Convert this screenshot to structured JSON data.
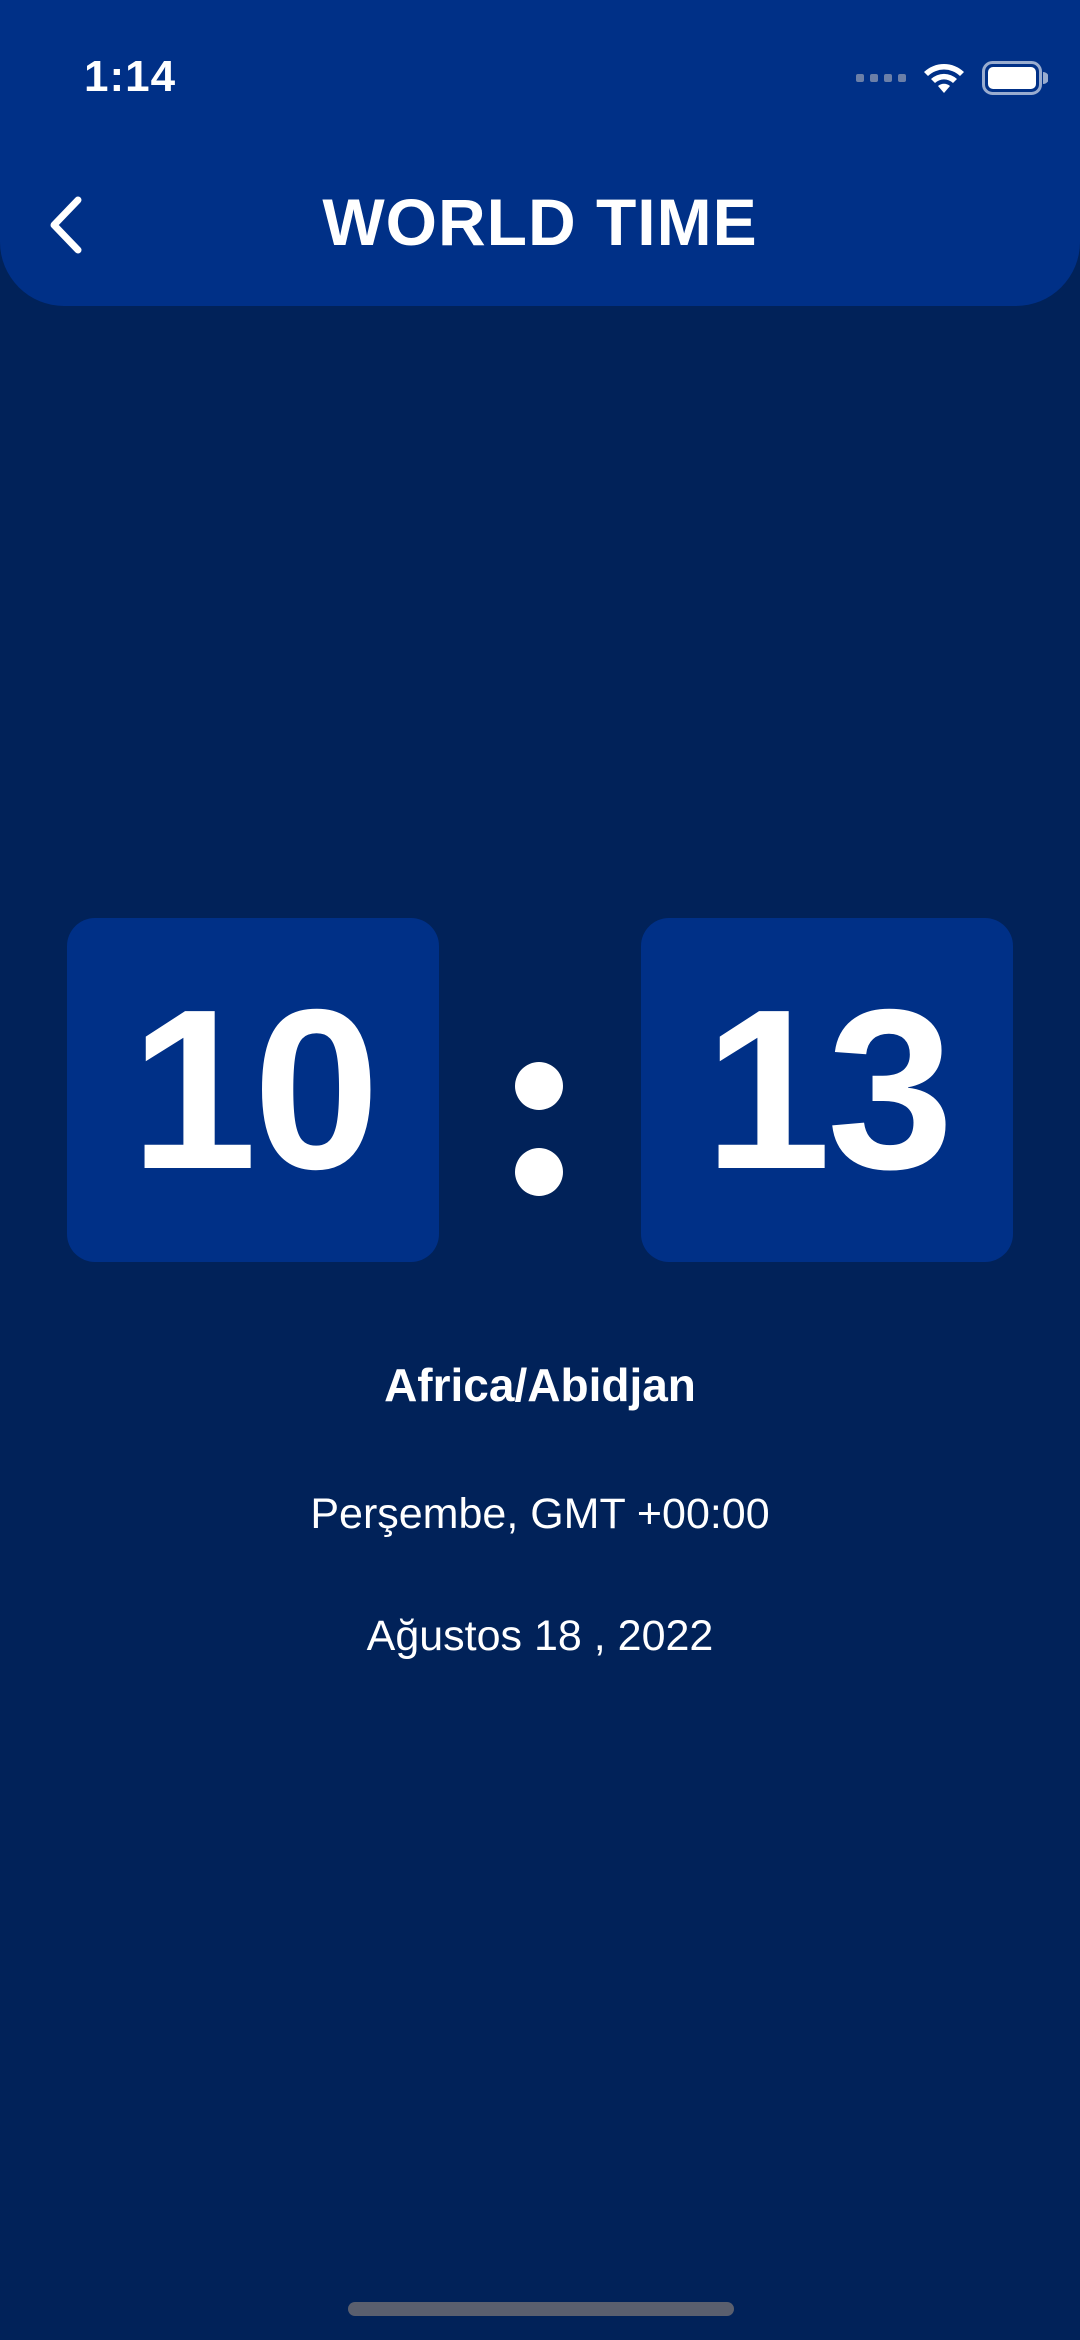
{
  "status_bar": {
    "time": "1:14",
    "icons": [
      "cellular-signal-icon",
      "wifi-icon",
      "battery-icon"
    ]
  },
  "header": {
    "title": "WORLD TIME",
    "back_icon": "chevron-left-icon"
  },
  "clock": {
    "hours": "10",
    "separator": ":",
    "minutes": "13"
  },
  "location": {
    "timezone": "Africa/Abidjan",
    "day_and_offset": "Perşembe, GMT +00:00",
    "date": "Ağustos 18 , 2022"
  },
  "colors": {
    "background": "#012259",
    "header": "#003087",
    "digit_box": "#003087",
    "text": "#ffffff"
  }
}
